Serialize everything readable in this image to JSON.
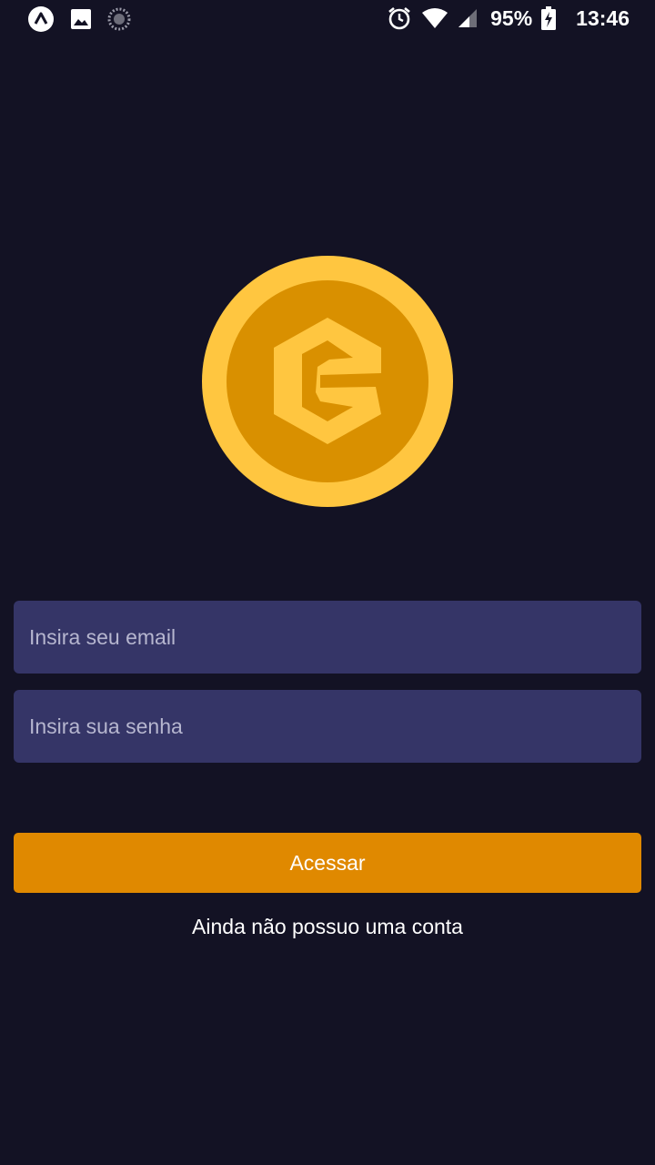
{
  "status_bar": {
    "icons_left": [
      "expo-icon",
      "image-notification-icon",
      "loading-spinner-icon"
    ],
    "icons_right": [
      "alarm-icon",
      "wifi-icon",
      "cell-signal-icon"
    ],
    "battery_percent": "95%",
    "time": "13:46"
  },
  "logo": {
    "name": "coin-logo",
    "colors": {
      "outer": "#ffc640",
      "inner": "#d99000",
      "mark": "#ffc640"
    }
  },
  "login_form": {
    "email_placeholder": "Insira seu email",
    "email_value": "",
    "password_placeholder": "Insira sua senha",
    "password_value": "",
    "submit_label": "Acessar",
    "signup_label": "Ainda não possuo uma conta"
  },
  "colors": {
    "background": "#131224",
    "input_background": "#353567",
    "button": "#e08900",
    "text": "#ffffff",
    "placeholder": "#b6b6cf"
  }
}
